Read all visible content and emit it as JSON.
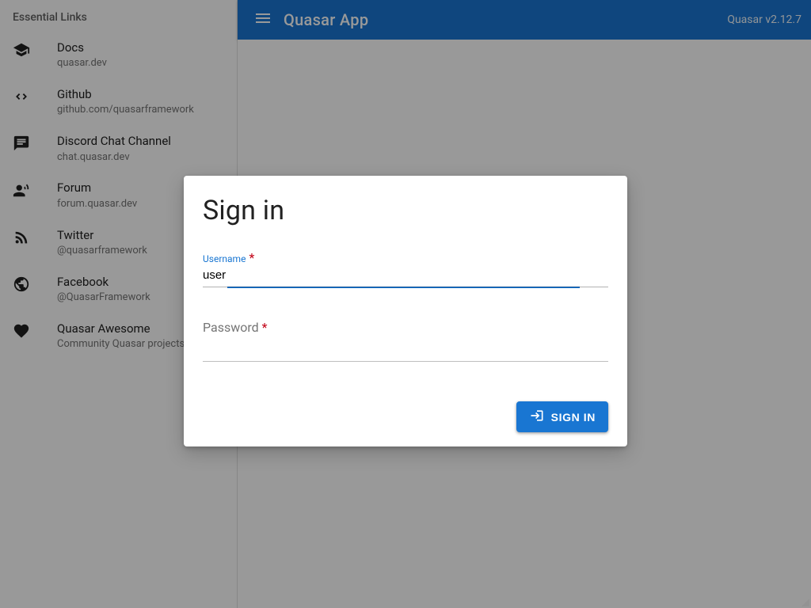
{
  "header": {
    "title": "Quasar App",
    "version": "Quasar v2.12.7"
  },
  "sidebar": {
    "title": "Essential Links",
    "items": [
      {
        "title": "Docs",
        "caption": "quasar.dev",
        "icon": "school"
      },
      {
        "title": "Github",
        "caption": "github.com/quasarframework",
        "icon": "code"
      },
      {
        "title": "Discord Chat Channel",
        "caption": "chat.quasar.dev",
        "icon": "chat"
      },
      {
        "title": "Forum",
        "caption": "forum.quasar.dev",
        "icon": "record-voice-over"
      },
      {
        "title": "Twitter",
        "caption": "@quasarframework",
        "icon": "rss-feed"
      },
      {
        "title": "Facebook",
        "caption": "@QuasarFramework",
        "icon": "public"
      },
      {
        "title": "Quasar Awesome",
        "caption": "Community Quasar projects",
        "icon": "favorite"
      }
    ]
  },
  "dialog": {
    "title": "Sign in",
    "username": {
      "label": "Username",
      "required": "*",
      "value": "user"
    },
    "password": {
      "label": "Password",
      "required": "*",
      "value": ""
    },
    "submit": "SIGN IN"
  }
}
